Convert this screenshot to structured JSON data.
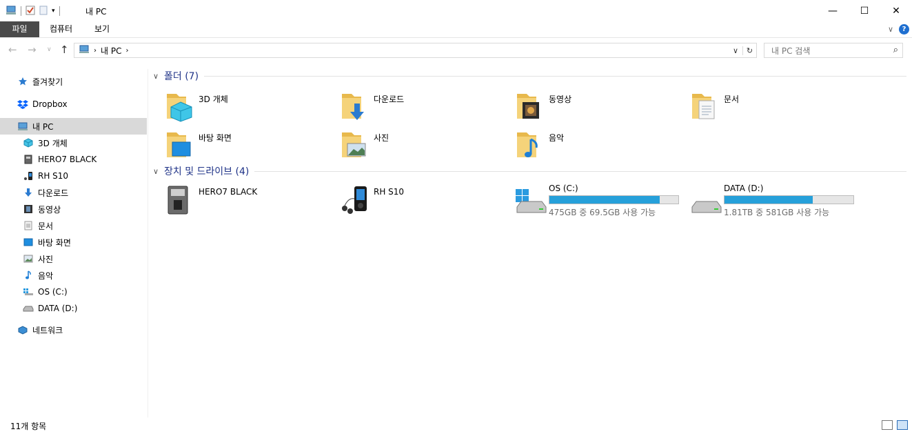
{
  "window": {
    "title": "내 PC"
  },
  "ribbon": {
    "tabs": [
      "파일",
      "컴퓨터",
      "보기"
    ]
  },
  "address": {
    "location": "내 PC"
  },
  "search": {
    "placeholder": "내 PC 검색"
  },
  "sidebar": {
    "items": [
      {
        "label": "즐겨찾기",
        "icon": "star-icon"
      },
      {
        "label": "Dropbox",
        "icon": "dropbox-icon"
      },
      {
        "label": "내 PC",
        "icon": "computer-icon",
        "selected": true
      },
      {
        "label": "3D 개체",
        "icon": "cube-icon"
      },
      {
        "label": "HERO7 BLACK",
        "icon": "camera-icon"
      },
      {
        "label": "RH S10",
        "icon": "media-player-icon"
      },
      {
        "label": "다운로드",
        "icon": "download-icon"
      },
      {
        "label": "동영상",
        "icon": "film-icon"
      },
      {
        "label": "문서",
        "icon": "document-icon"
      },
      {
        "label": "바탕 화면",
        "icon": "desktop-icon"
      },
      {
        "label": "사진",
        "icon": "picture-icon"
      },
      {
        "label": "음악",
        "icon": "music-icon"
      },
      {
        "label": "OS (C:)",
        "icon": "windows-drive-icon"
      },
      {
        "label": "DATA (D:)",
        "icon": "drive-icon"
      },
      {
        "label": "네트워크",
        "icon": "network-icon"
      }
    ]
  },
  "folders": {
    "header": "폴더 (7)",
    "items": [
      {
        "label": "3D 개체",
        "icon": "folder-3d-icon"
      },
      {
        "label": "다운로드",
        "icon": "folder-download-icon"
      },
      {
        "label": "동영상",
        "icon": "folder-video-icon"
      },
      {
        "label": "문서",
        "icon": "folder-document-icon"
      },
      {
        "label": "바탕 화면",
        "icon": "folder-desktop-icon"
      },
      {
        "label": "사진",
        "icon": "folder-picture-icon"
      },
      {
        "label": "음악",
        "icon": "folder-music-icon"
      }
    ]
  },
  "devices": {
    "header": "장치 및 드라이브 (4)",
    "items": [
      {
        "label": "HERO7 BLACK",
        "icon": "camera-device-icon"
      },
      {
        "label": "RH S10",
        "icon": "media-player-device-icon"
      },
      {
        "label": "OS (C:)",
        "icon": "windows-drive-icon",
        "usage": "475GB 중 69.5GB 사용 가능",
        "used_fraction": 0.854
      },
      {
        "label": "DATA (D:)",
        "icon": "drive-icon",
        "usage": "1.81TB 중 581GB 사용 가능",
        "used_fraction": 0.687
      }
    ]
  },
  "status": {
    "count": "11개 항목"
  },
  "colors": {
    "accent": "#1e3287",
    "usage_bar": "#26a0da",
    "selection": "#d9d9d9",
    "file_tab": "#4a4a4a"
  }
}
